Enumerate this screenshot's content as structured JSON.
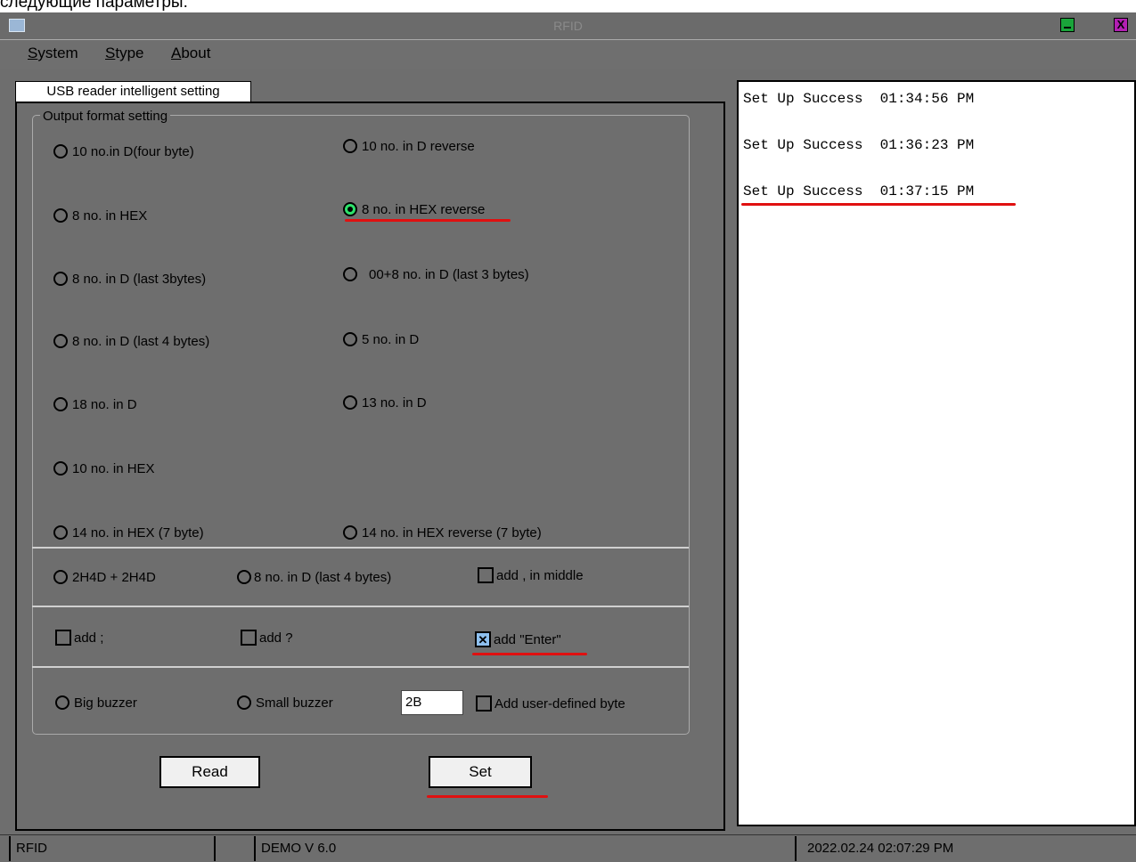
{
  "caption": "следующие параметры:",
  "window": {
    "title": "RFID",
    "close_glyph": "X"
  },
  "menu": {
    "system": "System",
    "stype": "Stype",
    "about": "About"
  },
  "tab_label": "USB reader intelligent setting",
  "group_title": "Output format setting",
  "formats": {
    "d10_four_byte": "10 no.in D(four byte)",
    "d10_reverse": "10 no. in D reverse",
    "hex8": "8 no. in HEX",
    "hex8_reverse": "8 no. in HEX reverse",
    "d8_last3": "8 no. in D (last 3bytes)",
    "d00_8_last3": "00+8 no. in D (last 3 bytes)",
    "d8_last4": "8 no. in D (last 4 bytes)",
    "d5": "5 no. in D",
    "d18": "18 no. in D",
    "d13": "13 no. in D",
    "hex10": "10 no. in HEX",
    "hex14": "14 no. in HEX (7 byte)",
    "hex14_reverse": "14 no. in HEX reverse (7 byte)",
    "h2h4d": "2H4D + 2H4D",
    "d8_last4_b": "8 no. in D (last 4 bytes)"
  },
  "selected_format": "hex8_reverse",
  "options": {
    "add_comma_middle": {
      "label": "add , in middle",
      "checked": false
    },
    "add_semicolon": {
      "label": "add ;",
      "checked": false
    },
    "add_question": {
      "label": "add ?",
      "checked": false
    },
    "add_enter": {
      "label": "add \"Enter\"",
      "checked": true
    },
    "add_user_byte": {
      "label": "Add  user-defined byte",
      "checked": false
    }
  },
  "buzzer": {
    "big": "Big buzzer",
    "small": "Small buzzer"
  },
  "user_byte_value": "2B",
  "buttons": {
    "read": "Read",
    "set": "Set"
  },
  "log": [
    {
      "text": "Set Up Success",
      "time": "01:34:56 PM"
    },
    {
      "text": "Set Up Success",
      "time": "01:36:23 PM"
    },
    {
      "text": "Set Up Success",
      "time": "01:37:15 PM"
    }
  ],
  "status": {
    "app": "RFID",
    "version": "DEMO V 6.0",
    "datetime": "2022.02.24  02:07:29 PM"
  },
  "colors": {
    "chrome": "#6e6e6e",
    "highlight": "#e01010",
    "radio_selected": "#2ee26b",
    "check_selected": "#8ec0ef"
  }
}
